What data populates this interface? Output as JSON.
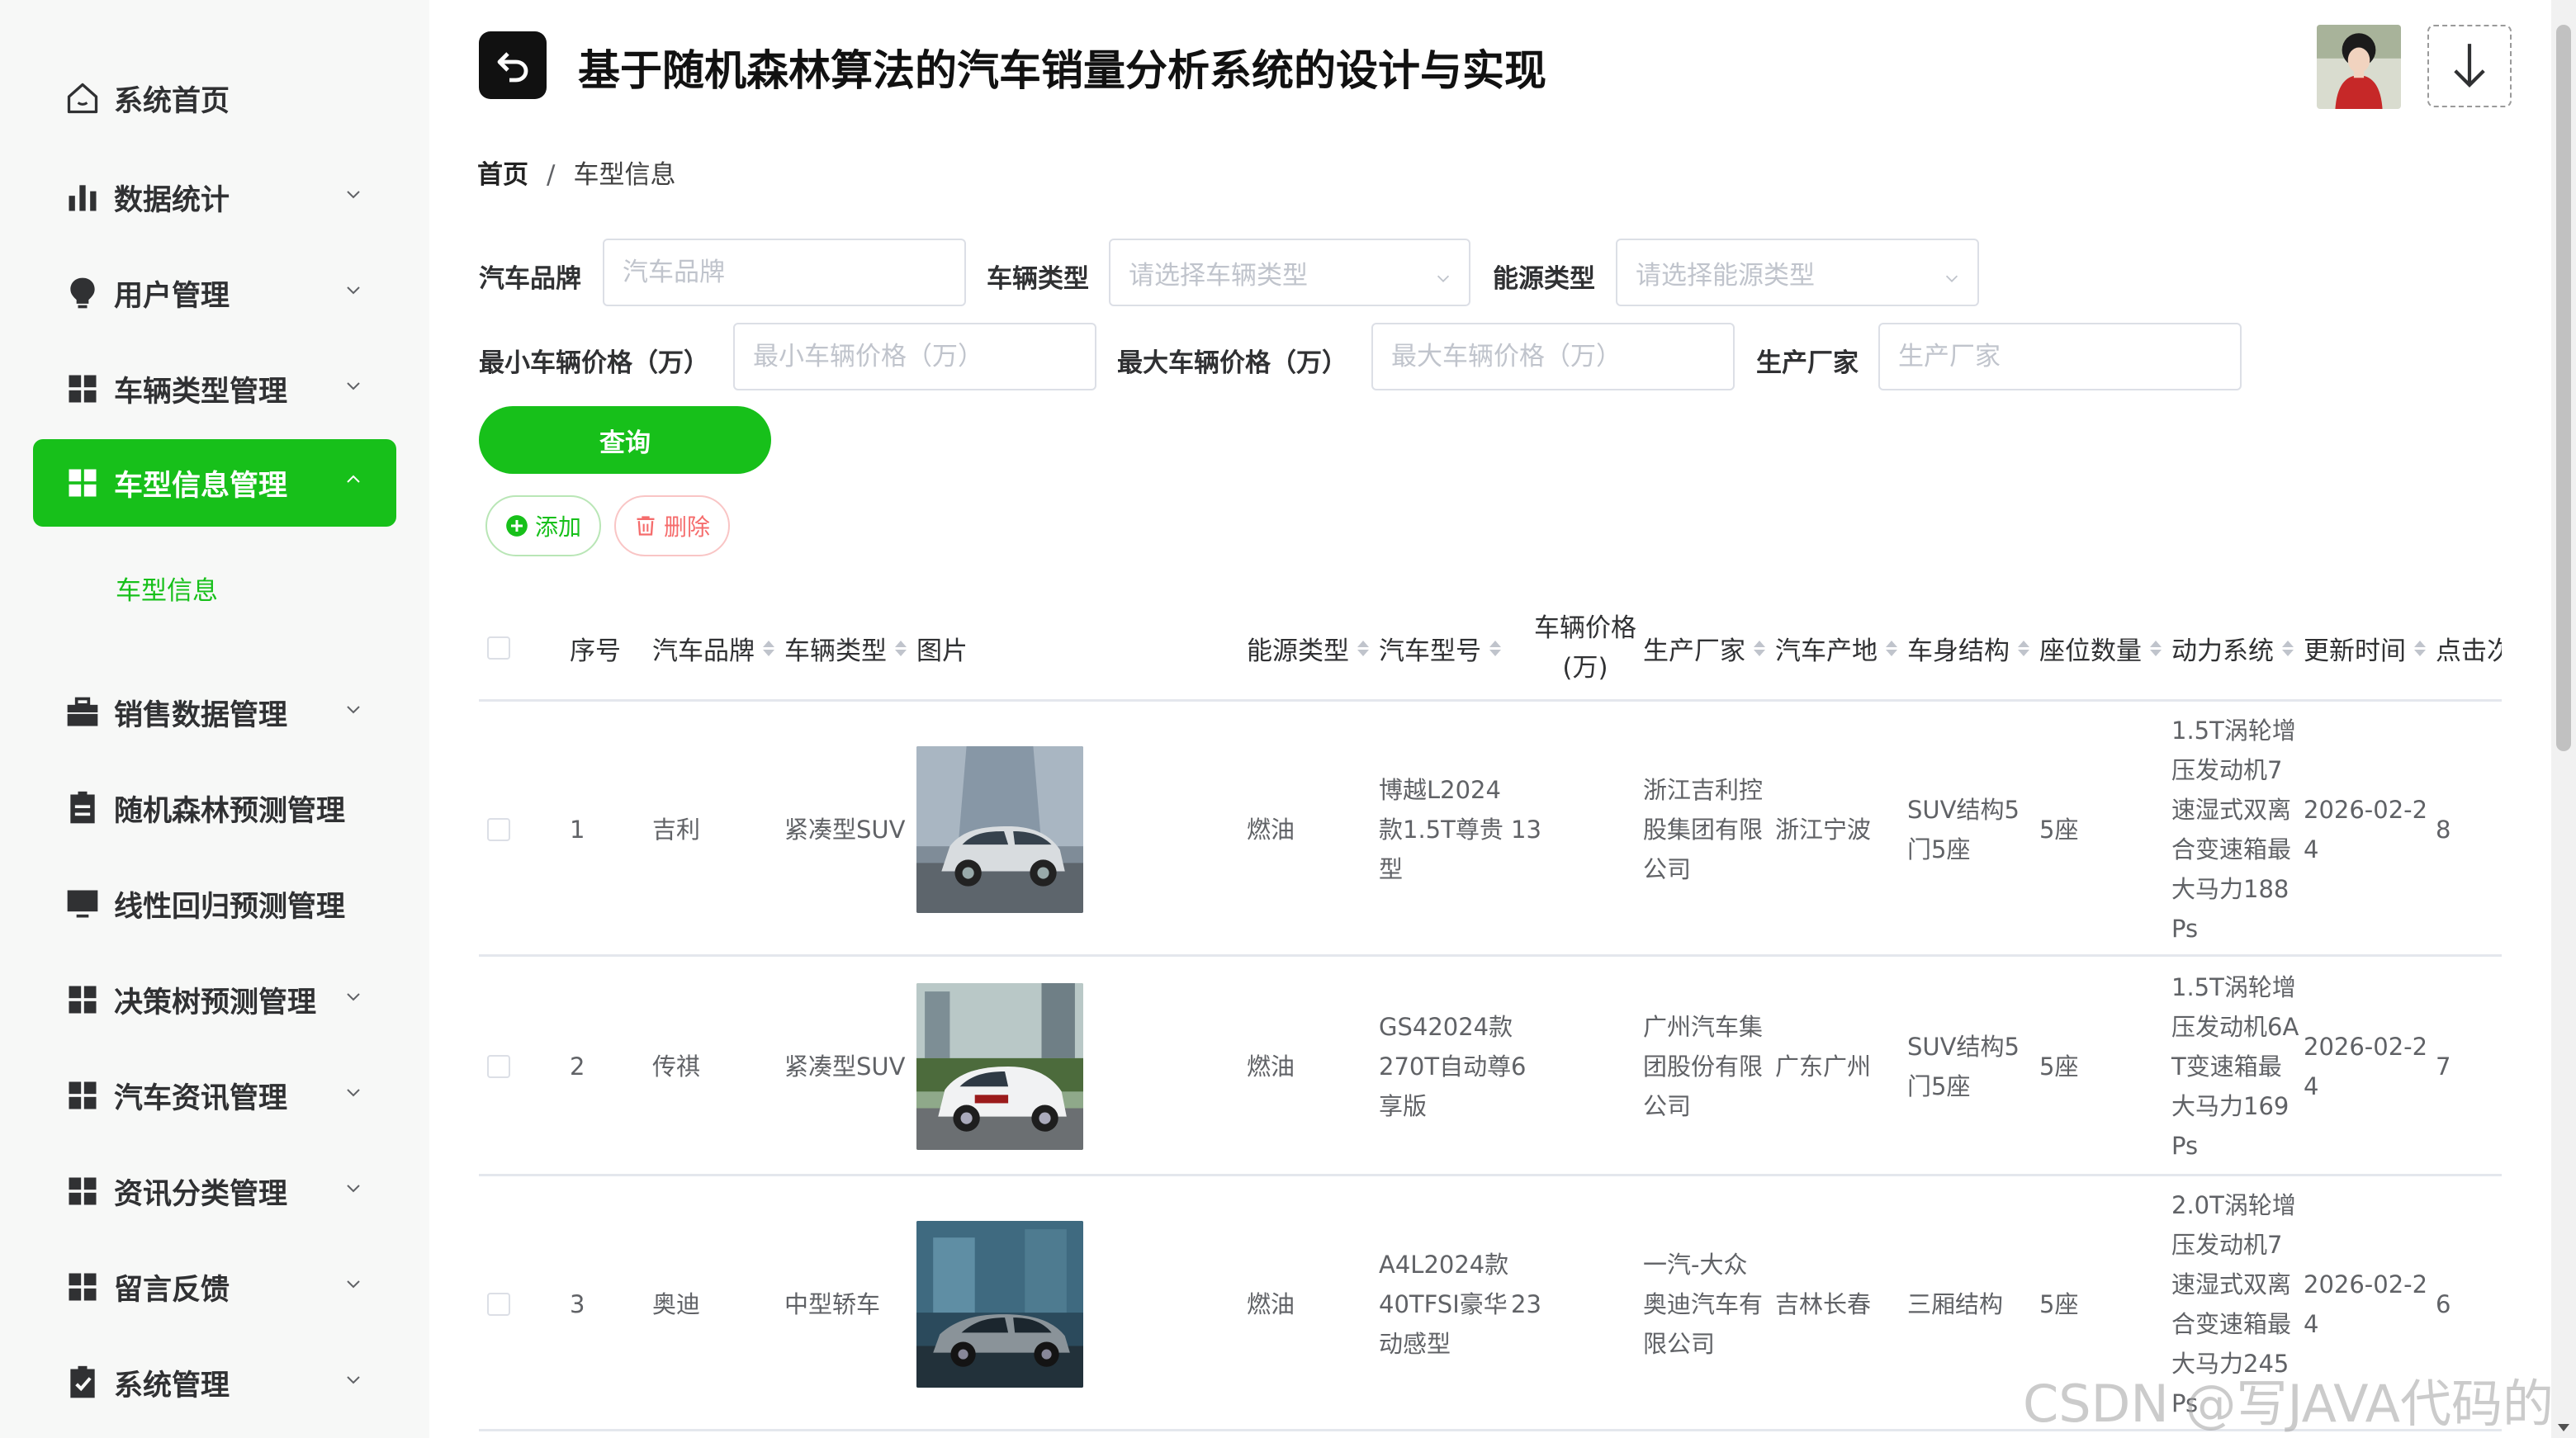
{
  "sidebar": {
    "items": [
      {
        "label": "系统首页",
        "icon": "home-icon"
      },
      {
        "label": "数据统计",
        "icon": "bar-chart-icon"
      },
      {
        "label": "用户管理",
        "icon": "bulb-icon"
      },
      {
        "label": "车辆类型管理",
        "icon": "grid-icon"
      },
      {
        "label": "车型信息管理",
        "icon": "grid-icon"
      },
      {
        "label": "销售数据管理",
        "icon": "briefcase-icon"
      },
      {
        "label": "随机森林预测管理",
        "icon": "document-icon"
      },
      {
        "label": "线性回归预测管理",
        "icon": "monitor-icon"
      },
      {
        "label": "决策树预测管理",
        "icon": "grid-icon"
      },
      {
        "label": "汽车资讯管理",
        "icon": "grid-icon"
      },
      {
        "label": "资讯分类管理",
        "icon": "grid-icon"
      },
      {
        "label": "留言反馈",
        "icon": "grid-icon"
      },
      {
        "label": "系统管理",
        "icon": "clipboard-check-icon"
      }
    ],
    "submenu_label": "车型信息",
    "accent": "#17c01a"
  },
  "header": {
    "title": "基于随机森林算法的汽车销量分析系统的设计与实现"
  },
  "breadcrumb": {
    "home": "首页",
    "separator": "/",
    "current": "车型信息"
  },
  "filters": {
    "brand": {
      "label": "汽车品牌",
      "placeholder": "汽车品牌"
    },
    "vehicle_type": {
      "label": "车辆类型",
      "placeholder": "请选择车辆类型"
    },
    "energy_type": {
      "label": "能源类型",
      "placeholder": "请选择能源类型"
    },
    "min_price": {
      "label": "最小车辆价格（万）",
      "placeholder": "最小车辆价格（万）"
    },
    "max_price": {
      "label": "最大车辆价格（万）",
      "placeholder": "最大车辆价格（万）"
    },
    "manufacturer": {
      "label": "生产厂家",
      "placeholder": "生产厂家"
    },
    "query_label": "查询"
  },
  "actions": {
    "add_label": "添加",
    "delete_label": "删除"
  },
  "table": {
    "headers": {
      "index": "序号",
      "brand": "汽车品牌",
      "type": "车辆类型",
      "image": "图片",
      "energy": "能源类型",
      "model": "汽车型号",
      "price_line1": "车辆价格",
      "price_line2": "(万)",
      "manufacturer": "生产厂家",
      "origin": "汽车产地",
      "body": "车身结构",
      "seats": "座位数量",
      "power": "动力系统",
      "updated": "更新时间",
      "clicks": "点击次"
    },
    "rows": [
      {
        "index": "1",
        "brand": "吉利",
        "type": "紧凑型SUV",
        "image": "geely-suv-photo",
        "energy": "燃油",
        "model": [
          "博越L2024",
          "款1.5T尊贵",
          "型"
        ],
        "price": "13",
        "manufacturer": [
          "浙江吉利控",
          "股集团有限",
          "公司"
        ],
        "origin": "浙江宁波",
        "body": [
          "SUV结构5",
          "门5座"
        ],
        "seats": "5座",
        "power": [
          "1.5T涡轮增",
          "压发动机7",
          "速湿式双离",
          "合变速箱最",
          "大马力188",
          "Ps"
        ],
        "updated": [
          "2026-02-2",
          "4"
        ],
        "clicks": "8"
      },
      {
        "index": "2",
        "brand": "传祺",
        "type": "紧凑型SUV",
        "image": "trumpchi-suv-photo",
        "energy": "燃油",
        "model": [
          "GS42024款",
          "270T自动尊",
          "享版"
        ],
        "price": "6",
        "manufacturer": [
          "广州汽车集",
          "团股份有限",
          "公司"
        ],
        "origin": "广东广州",
        "body": [
          "SUV结构5",
          "门5座"
        ],
        "seats": "5座",
        "power": [
          "1.5T涡轮增",
          "压发动机6A",
          "T变速箱最",
          "大马力169",
          "Ps"
        ],
        "updated": [
          "2026-02-2",
          "4"
        ],
        "clicks": "7"
      },
      {
        "index": "3",
        "brand": "奥迪",
        "type": "中型轿车",
        "image": "audi-sedan-photo",
        "energy": "燃油",
        "model": [
          "A4L2024款",
          "40TFSI豪华",
          "动感型"
        ],
        "price": "23",
        "manufacturer": [
          "一汽-大众",
          "奥迪汽车有",
          "限公司"
        ],
        "origin": "吉林长春",
        "body": [
          "三厢结构"
        ],
        "seats": "5座",
        "power": [
          "2.0T涡轮增",
          "压发动机7",
          "速湿式双离",
          "合变速箱最",
          "大马力245",
          "Ps"
        ],
        "updated": [
          "2026-02-2",
          "4"
        ],
        "clicks": "6"
      }
    ]
  },
  "watermark": "CSDN @写JAVA代码的人"
}
